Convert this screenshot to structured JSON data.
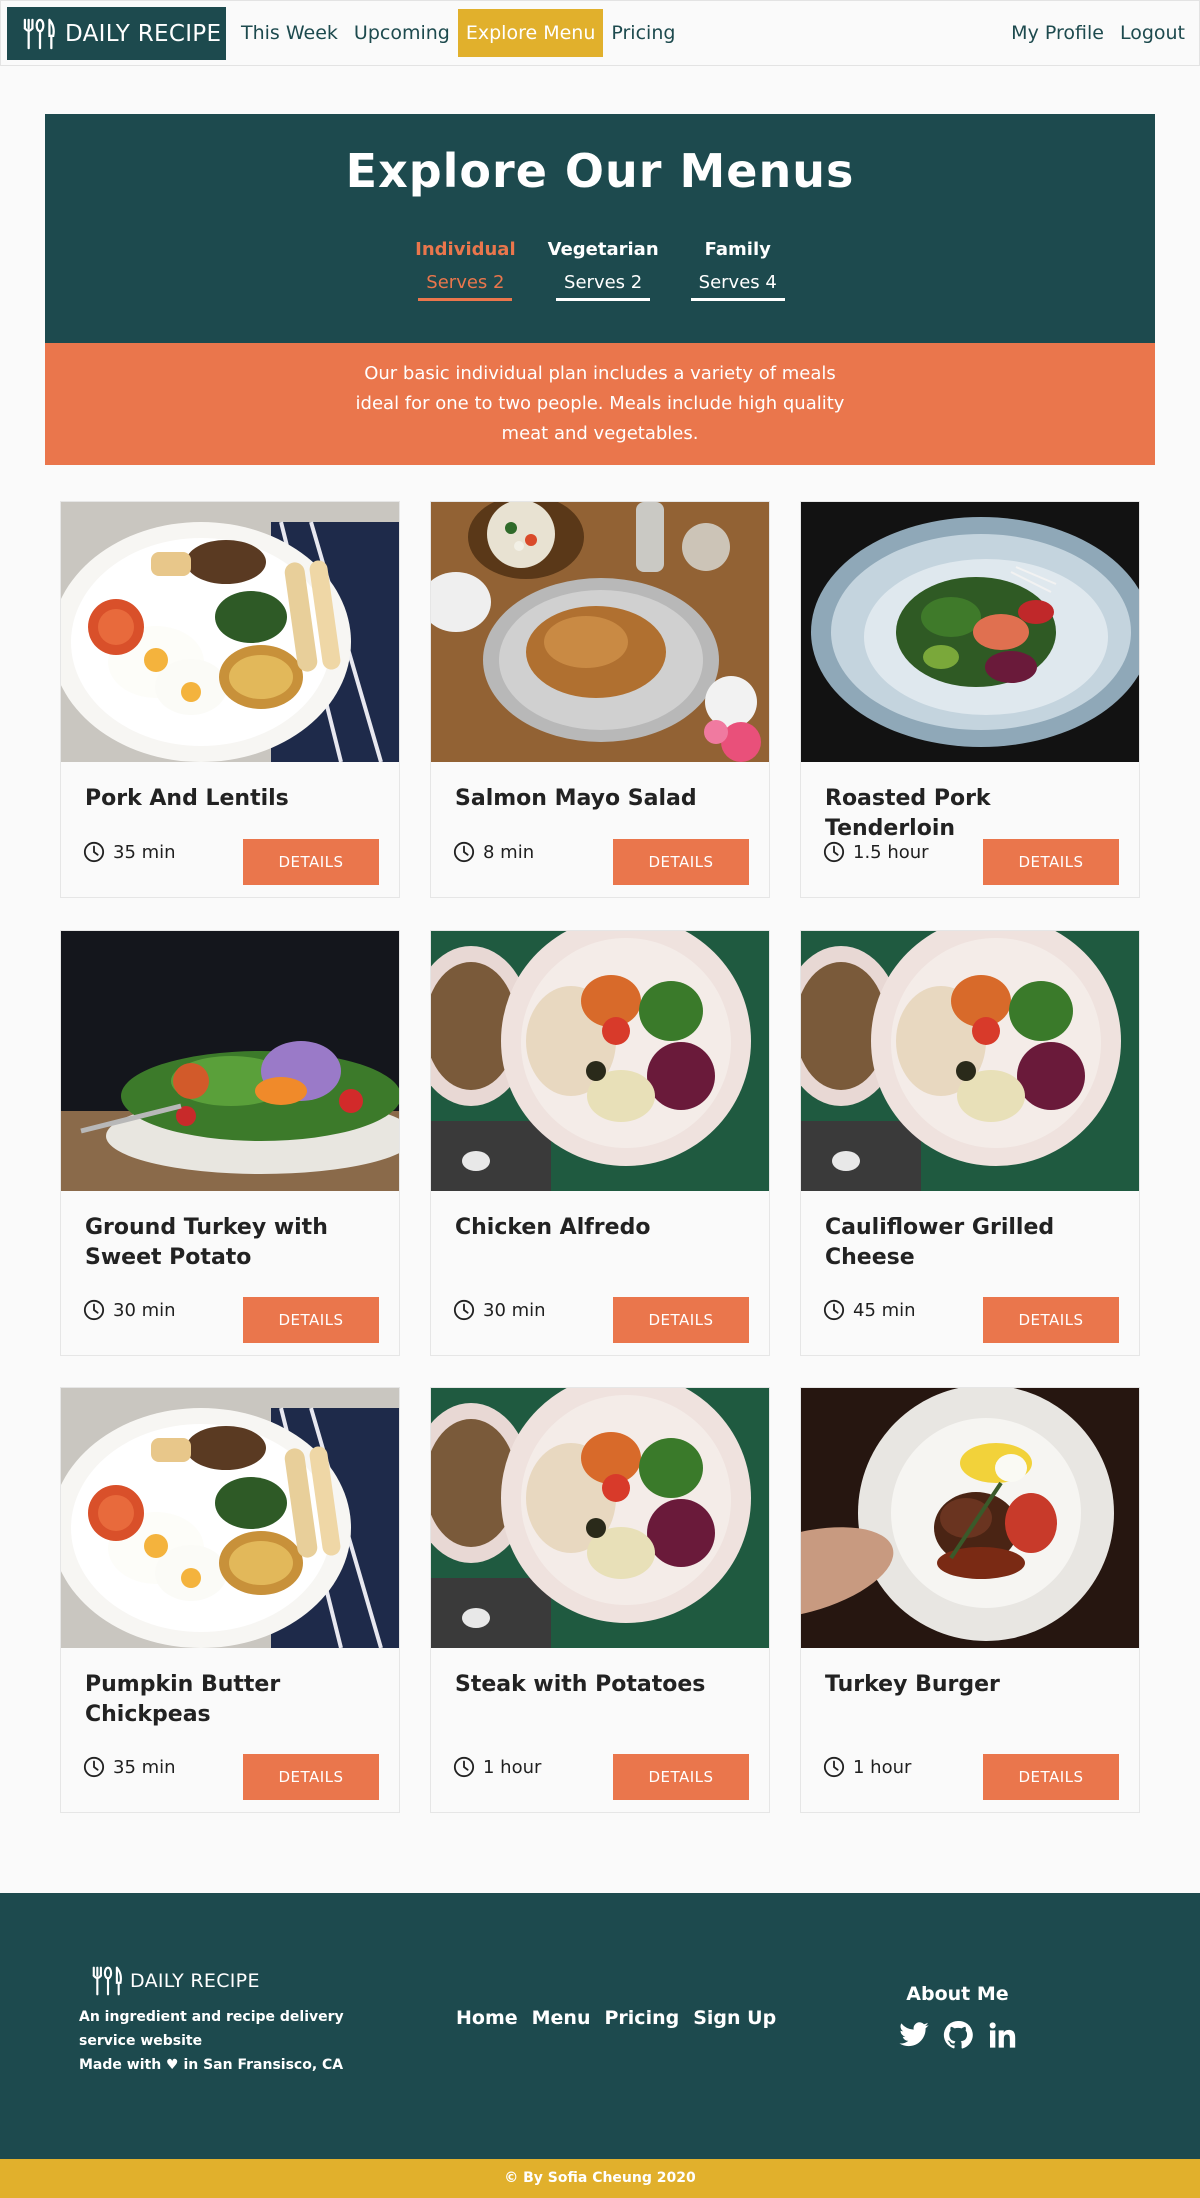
{
  "nav": {
    "brand": "DAILY RECIPE",
    "links": [
      "This Week",
      "Upcoming",
      "Explore Menu",
      "Pricing"
    ],
    "active_link": "Explore Menu",
    "right_links": [
      "My Profile",
      "Logout"
    ]
  },
  "hero": {
    "title": "Explore Our Menus",
    "tabs": [
      {
        "name": "Individual",
        "serves": "Serves 2",
        "active": true
      },
      {
        "name": "Vegetarian",
        "serves": "Serves 2",
        "active": false
      },
      {
        "name": "Family",
        "serves": "Serves 4",
        "active": false
      }
    ],
    "description": "Our basic individual plan includes a variety of meals ideal for one to two people. Meals include high quality meat and vegetables."
  },
  "menu_items": [
    {
      "title": "Pork And Lentils",
      "time": "35 min",
      "button": "DETAILS"
    },
    {
      "title": "Salmon Mayo Salad",
      "time": "8 min",
      "button": "DETAILS"
    },
    {
      "title": "Roasted Pork Tenderloin",
      "time": "1.5 hour",
      "button": "DETAILS"
    },
    {
      "title": "Ground Turkey with Sweet Potato",
      "time": "30 min",
      "button": "DETAILS"
    },
    {
      "title": "Chicken Alfredo",
      "time": "30 min",
      "button": "DETAILS"
    },
    {
      "title": "Cauliflower Grilled Cheese",
      "time": "45 min",
      "button": "DETAILS"
    },
    {
      "title": "Pumpkin Butter Chickpeas",
      "time": "35 min",
      "button": "DETAILS"
    },
    {
      "title": "Steak with Potatoes",
      "time": "1 hour",
      "button": "DETAILS"
    },
    {
      "title": "Turkey Burger",
      "time": "1 hour",
      "button": "DETAILS"
    }
  ],
  "footer": {
    "brand": "DAILY RECIPE",
    "tagline": "An ingredient and recipe delivery service website",
    "made_with": "Made with ♥ in San Fransisco, CA",
    "links": [
      "Home",
      "Menu",
      "Pricing",
      "Sign Up"
    ],
    "about_title": "About Me",
    "social_icons": [
      "twitter-icon",
      "github-icon",
      "linkedin-icon"
    ],
    "copyright": "© By Sofia Cheung 2020"
  },
  "colors": {
    "primary": "#1d4a4e",
    "accent": "#ea764c",
    "highlight": "#e1b02c",
    "background": "#fafafa"
  }
}
